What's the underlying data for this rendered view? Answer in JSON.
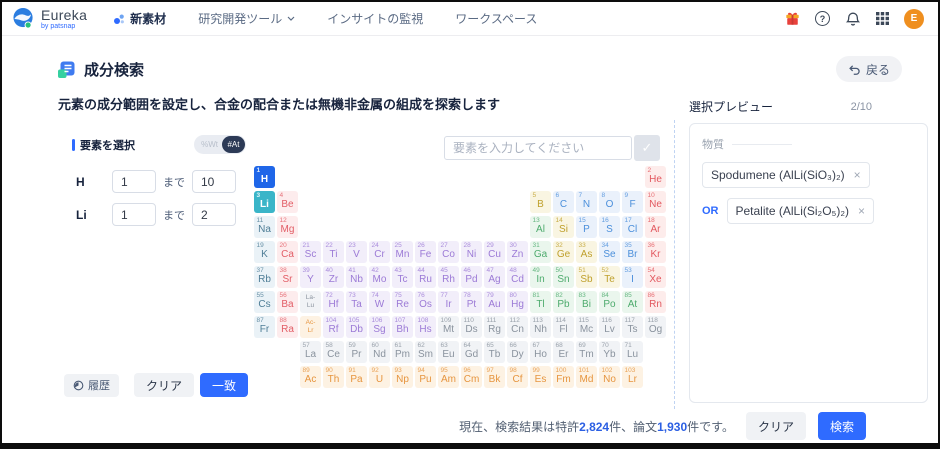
{
  "navbar": {
    "logo": {
      "title": "Eureka",
      "subtitle": "by patsnap"
    },
    "items": [
      {
        "label": "新素材"
      },
      {
        "label": "研究開発ツール"
      },
      {
        "label": "インサイトの監視"
      },
      {
        "label": "ワークスペース"
      }
    ],
    "avatar": "E"
  },
  "icons": {
    "help": "?",
    "check": "✓",
    "close": "×"
  },
  "page": {
    "title": "成分検索",
    "back_label": "戻る",
    "description": "元素の成分範囲を設定し、合金の配合または無機非金属の組成を探索します"
  },
  "element_panel": {
    "title": "要素を選択",
    "unit_toggle": {
      "off_option": "%Wt",
      "on_option": "#At",
      "selected": "#At"
    },
    "rows": [
      {
        "symbol": "H",
        "min": "1",
        "to_label": "まで",
        "max": "10"
      },
      {
        "symbol": "Li",
        "min": "1",
        "to_label": "まで",
        "max": "2"
      }
    ],
    "history_label": "履歴",
    "clear_label": "クリア",
    "match_label": "一致"
  },
  "periodic": {
    "search_placeholder": "要素を入力してください",
    "colors": {
      "hsel": {
        "bg": "#1f66e8",
        "fg": "#ffffff"
      },
      "lisel": {
        "bg": "#3ab5c8",
        "fg": "#ffffff"
      },
      "alk": {
        "bg": "#eaf2f7",
        "fg": "#4e7d96"
      },
      "ae": {
        "bg": "#fdeced",
        "fg": "#e25d66"
      },
      "ng": {
        "bg": "#fdeceb",
        "fg": "#e2575e"
      },
      "tm": {
        "bg": "#f2eefa",
        "fg": "#9c7ad6"
      },
      "pt": {
        "bg": "#eaf6ed",
        "fg": "#4dab6d"
      },
      "md": {
        "bg": "#f9f5e2",
        "fg": "#bfa02c"
      },
      "nm": {
        "bg": "#eaf1fb",
        "fg": "#4b8fdb"
      },
      "ln": {
        "bg": "#f1f3f6",
        "fg": "#8a939e"
      },
      "un": {
        "bg": "#f1f3f6",
        "fg": "#8a939e"
      },
      "an": {
        "bg": "#fdf2e3",
        "fg": "#e6953f"
      },
      "lnp": {
        "bg": "#f1f3f6",
        "fg": "#8a939e"
      },
      "anp": {
        "bg": "#fdf2e3",
        "fg": "#e6953f"
      }
    },
    "elements": [
      [
        "H",
        1,
        1,
        1,
        "hsel"
      ],
      [
        "He",
        2,
        1,
        18,
        "ng"
      ],
      [
        "Li",
        3,
        2,
        1,
        "lisel"
      ],
      [
        "Be",
        4,
        2,
        2,
        "ae"
      ],
      [
        "B",
        5,
        2,
        13,
        "md"
      ],
      [
        "C",
        6,
        2,
        14,
        "nm"
      ],
      [
        "N",
        7,
        2,
        15,
        "nm"
      ],
      [
        "O",
        8,
        2,
        16,
        "nm"
      ],
      [
        "F",
        9,
        2,
        17,
        "nm"
      ],
      [
        "Ne",
        10,
        2,
        18,
        "ng"
      ],
      [
        "Na",
        11,
        3,
        1,
        "alk"
      ],
      [
        "Mg",
        12,
        3,
        2,
        "ae"
      ],
      [
        "Al",
        13,
        3,
        13,
        "pt"
      ],
      [
        "Si",
        14,
        3,
        14,
        "md"
      ],
      [
        "P",
        15,
        3,
        15,
        "nm"
      ],
      [
        "S",
        16,
        3,
        16,
        "nm"
      ],
      [
        "Cl",
        17,
        3,
        17,
        "nm"
      ],
      [
        "Ar",
        18,
        3,
        18,
        "ng"
      ],
      [
        "K",
        19,
        4,
        1,
        "alk"
      ],
      [
        "Ca",
        20,
        4,
        2,
        "ae"
      ],
      [
        "Sc",
        21,
        4,
        3,
        "tm"
      ],
      [
        "Ti",
        22,
        4,
        4,
        "tm"
      ],
      [
        "V",
        23,
        4,
        5,
        "tm"
      ],
      [
        "Cr",
        24,
        4,
        6,
        "tm"
      ],
      [
        "Mn",
        25,
        4,
        7,
        "tm"
      ],
      [
        "Fe",
        26,
        4,
        8,
        "tm"
      ],
      [
        "Co",
        27,
        4,
        9,
        "tm"
      ],
      [
        "Ni",
        28,
        4,
        10,
        "tm"
      ],
      [
        "Cu",
        29,
        4,
        11,
        "tm"
      ],
      [
        "Zn",
        30,
        4,
        12,
        "tm"
      ],
      [
        "Ga",
        31,
        4,
        13,
        "pt"
      ],
      [
        "Ge",
        32,
        4,
        14,
        "md"
      ],
      [
        "As",
        33,
        4,
        15,
        "md"
      ],
      [
        "Se",
        34,
        4,
        16,
        "nm"
      ],
      [
        "Br",
        35,
        4,
        17,
        "nm"
      ],
      [
        "Kr",
        36,
        4,
        18,
        "ng"
      ],
      [
        "Rb",
        37,
        5,
        1,
        "alk"
      ],
      [
        "Sr",
        38,
        5,
        2,
        "ae"
      ],
      [
        "Y",
        39,
        5,
        3,
        "tm"
      ],
      [
        "Zr",
        40,
        5,
        4,
        "tm"
      ],
      [
        "Nb",
        41,
        5,
        5,
        "tm"
      ],
      [
        "Mo",
        42,
        5,
        6,
        "tm"
      ],
      [
        "Tc",
        43,
        5,
        7,
        "tm"
      ],
      [
        "Ru",
        44,
        5,
        8,
        "tm"
      ],
      [
        "Rh",
        45,
        5,
        9,
        "tm"
      ],
      [
        "Pd",
        46,
        5,
        10,
        "tm"
      ],
      [
        "Ag",
        47,
        5,
        11,
        "tm"
      ],
      [
        "Cd",
        48,
        5,
        12,
        "tm"
      ],
      [
        "In",
        49,
        5,
        13,
        "pt"
      ],
      [
        "Sn",
        50,
        5,
        14,
        "pt"
      ],
      [
        "Sb",
        51,
        5,
        15,
        "md"
      ],
      [
        "Te",
        52,
        5,
        16,
        "md"
      ],
      [
        "I",
        53,
        5,
        17,
        "nm"
      ],
      [
        "Xe",
        54,
        5,
        18,
        "ng"
      ],
      [
        "Cs",
        55,
        6,
        1,
        "alk"
      ],
      [
        "Ba",
        56,
        6,
        2,
        "ae"
      ],
      [
        "La-|Lu",
        null,
        6,
        3,
        "lnp"
      ],
      [
        "Hf",
        72,
        6,
        4,
        "tm"
      ],
      [
        "Ta",
        73,
        6,
        5,
        "tm"
      ],
      [
        "W",
        74,
        6,
        6,
        "tm"
      ],
      [
        "Re",
        75,
        6,
        7,
        "tm"
      ],
      [
        "Os",
        76,
        6,
        8,
        "tm"
      ],
      [
        "Ir",
        77,
        6,
        9,
        "tm"
      ],
      [
        "Pt",
        78,
        6,
        10,
        "tm"
      ],
      [
        "Au",
        79,
        6,
        11,
        "tm"
      ],
      [
        "Hg",
        80,
        6,
        12,
        "tm"
      ],
      [
        "Tl",
        81,
        6,
        13,
        "pt"
      ],
      [
        "Pb",
        82,
        6,
        14,
        "pt"
      ],
      [
        "Bi",
        83,
        6,
        15,
        "pt"
      ],
      [
        "Po",
        84,
        6,
        16,
        "pt"
      ],
      [
        "At",
        85,
        6,
        17,
        "pt"
      ],
      [
        "Rn",
        86,
        6,
        18,
        "ng"
      ],
      [
        "Fr",
        87,
        7,
        1,
        "alk"
      ],
      [
        "Ra",
        88,
        7,
        2,
        "ae"
      ],
      [
        "Ac-|Lr",
        null,
        7,
        3,
        "anp"
      ],
      [
        "Rf",
        104,
        7,
        4,
        "tm"
      ],
      [
        "Db",
        105,
        7,
        5,
        "tm"
      ],
      [
        "Sg",
        106,
        7,
        6,
        "tm"
      ],
      [
        "Bh",
        107,
        7,
        7,
        "tm"
      ],
      [
        "Hs",
        108,
        7,
        8,
        "tm"
      ],
      [
        "Mt",
        109,
        7,
        9,
        "un"
      ],
      [
        "Ds",
        110,
        7,
        10,
        "un"
      ],
      [
        "Rg",
        111,
        7,
        11,
        "un"
      ],
      [
        "Cn",
        112,
        7,
        12,
        "un"
      ],
      [
        "Nh",
        113,
        7,
        13,
        "un"
      ],
      [
        "Fl",
        114,
        7,
        14,
        "un"
      ],
      [
        "Mc",
        115,
        7,
        15,
        "un"
      ],
      [
        "Lv",
        116,
        7,
        16,
        "un"
      ],
      [
        "Ts",
        117,
        7,
        17,
        "un"
      ],
      [
        "Og",
        118,
        7,
        18,
        "un"
      ],
      [
        "La",
        57,
        8,
        3,
        "ln"
      ],
      [
        "Ce",
        58,
        8,
        4,
        "ln"
      ],
      [
        "Pr",
        59,
        8,
        5,
        "ln"
      ],
      [
        "Nd",
        60,
        8,
        6,
        "ln"
      ],
      [
        "Pm",
        61,
        8,
        7,
        "ln"
      ],
      [
        "Sm",
        62,
        8,
        8,
        "ln"
      ],
      [
        "Eu",
        63,
        8,
        9,
        "ln"
      ],
      [
        "Gd",
        64,
        8,
        10,
        "ln"
      ],
      [
        "Tb",
        65,
        8,
        11,
        "ln"
      ],
      [
        "Dy",
        66,
        8,
        12,
        "ln"
      ],
      [
        "Ho",
        67,
        8,
        13,
        "ln"
      ],
      [
        "Er",
        68,
        8,
        14,
        "ln"
      ],
      [
        "Tm",
        69,
        8,
        15,
        "ln"
      ],
      [
        "Yb",
        70,
        8,
        16,
        "ln"
      ],
      [
        "Lu",
        71,
        8,
        17,
        "ln"
      ],
      [
        "Ac",
        89,
        9,
        3,
        "an"
      ],
      [
        "Th",
        90,
        9,
        4,
        "an"
      ],
      [
        "Pa",
        91,
        9,
        5,
        "an"
      ],
      [
        "U",
        92,
        9,
        6,
        "an"
      ],
      [
        "Np",
        93,
        9,
        7,
        "an"
      ],
      [
        "Pu",
        94,
        9,
        8,
        "an"
      ],
      [
        "Am",
        95,
        9,
        9,
        "an"
      ],
      [
        "Cm",
        96,
        9,
        10,
        "an"
      ],
      [
        "Bk",
        97,
        9,
        11,
        "an"
      ],
      [
        "Cf",
        98,
        9,
        12,
        "an"
      ],
      [
        "Es",
        99,
        9,
        13,
        "an"
      ],
      [
        "Fm",
        100,
        9,
        14,
        "an"
      ],
      [
        "Md",
        101,
        9,
        15,
        "an"
      ],
      [
        "No",
        102,
        9,
        16,
        "an"
      ],
      [
        "Lr",
        103,
        9,
        17,
        "an"
      ]
    ]
  },
  "preview": {
    "title": "選択プレビュー",
    "count": "2/10",
    "group_label": "物質",
    "items": [
      {
        "prefix": "",
        "label": "Spodumene (AlLi(SiO₃)₂)"
      },
      {
        "prefix": "OR",
        "label": "Petalite (AlLi(Si₂O₅)₂)"
      }
    ]
  },
  "footer": {
    "result_text_parts": [
      "現在、検索結果は特許",
      "2,824",
      "件、論文",
      "1,930",
      "件です。"
    ],
    "clear_label": "クリア",
    "search_label": "検索"
  }
}
